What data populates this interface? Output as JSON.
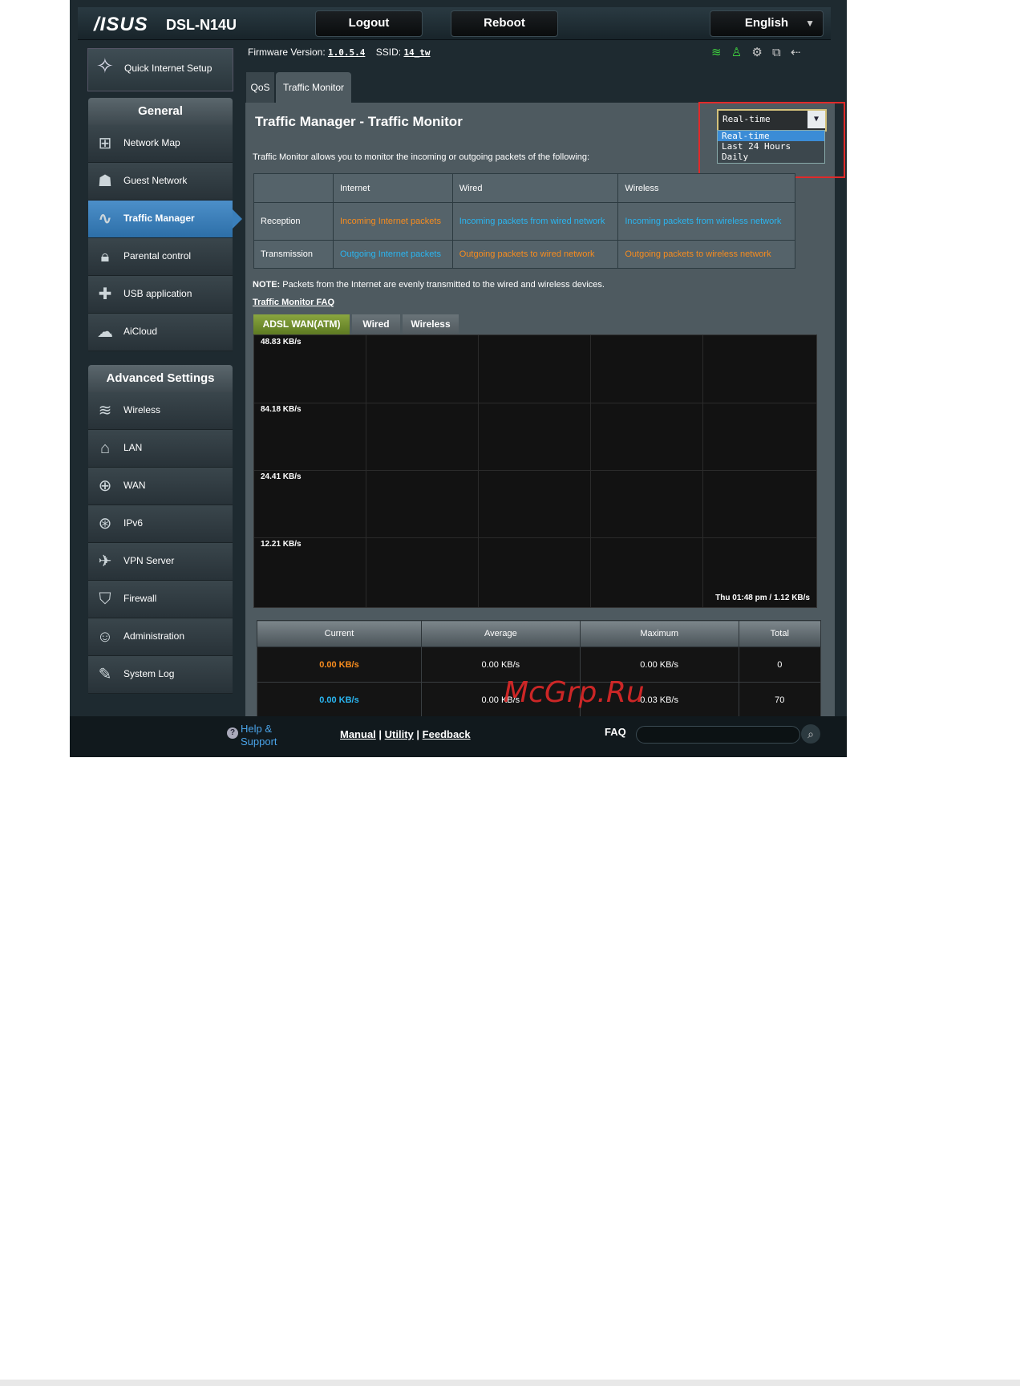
{
  "header": {
    "brand": "/ISUS",
    "model": "DSL-N14U",
    "logout_label": "Logout",
    "reboot_label": "Reboot",
    "language": "English"
  },
  "sidebar": {
    "quick_setup": "Quick Internet Setup",
    "general_title": "General",
    "general_items": [
      {
        "label": "Network Map",
        "icon": "network-map-icon"
      },
      {
        "label": "Guest Network",
        "icon": "guest-network-icon"
      },
      {
        "label": "Traffic Manager",
        "icon": "traffic-manager-icon"
      },
      {
        "label": "Parental control",
        "icon": "lock-icon"
      },
      {
        "label": "USB application",
        "icon": "puzzle-icon"
      },
      {
        "label": "AiCloud",
        "icon": "cloud-icon"
      }
    ],
    "advanced_title": "Advanced Settings",
    "advanced_items": [
      {
        "label": "Wireless",
        "icon": "wifi-icon"
      },
      {
        "label": "LAN",
        "icon": "home-icon"
      },
      {
        "label": "WAN",
        "icon": "globe-icon"
      },
      {
        "label": "IPv6",
        "icon": "ipv6-icon"
      },
      {
        "label": "VPN Server",
        "icon": "vpn-icon"
      },
      {
        "label": "Firewall",
        "icon": "shield-icon"
      },
      {
        "label": "Administration",
        "icon": "user-icon"
      },
      {
        "label": "System Log",
        "icon": "log-icon"
      }
    ]
  },
  "status": {
    "firmware_label": "Firmware Version:",
    "firmware_value": "1.0.5.4",
    "ssid_label": "SSID:",
    "ssid_value": "14_tw"
  },
  "tabs": [
    "QoS",
    "Traffic Monitor"
  ],
  "page": {
    "title": "Traffic Manager - Traffic Monitor",
    "select_value": "Real-time",
    "select_options": [
      "Real-time",
      "Last 24 Hours",
      "Daily"
    ],
    "description": "Traffic Monitor allows you to monitor the incoming or outgoing packets of the following:",
    "table": {
      "headers": [
        "",
        "Internet",
        "Wired",
        "Wireless"
      ],
      "rows": [
        [
          "Reception",
          "Incoming Internet packets",
          "Incoming packets from wired network",
          "Incoming packets from wireless network"
        ],
        [
          "Transmission",
          "Outgoing Internet packets",
          "Outgoing packets to wired network",
          "Outgoing packets to wireless network"
        ]
      ]
    },
    "note_label": "NOTE:",
    "note_text": " Packets from the Internet are evenly transmitted to the wired and wireless devices.",
    "faq_link": "Traffic Monitor FAQ"
  },
  "graph": {
    "tabs": [
      "ADSL WAN(ATM)",
      "Wired",
      "Wireless"
    ],
    "y_labels": [
      "48.83 KB/s",
      "84.18 KB/s",
      "24.41 KB/s",
      "12.21 KB/s"
    ],
    "timestamp": "Thu 01:48 pm / 1.12 KB/s"
  },
  "stats": {
    "headers": [
      "Current",
      "Average",
      "Maximum",
      "Total"
    ],
    "rows": [
      [
        "0.00 KB/s",
        "0.00 KB/s",
        "0.00 KB/s",
        "0"
      ],
      [
        "0.00 KB/s",
        "0.00 KB/s",
        "0.03 KB/s",
        "70"
      ]
    ]
  },
  "footer": {
    "help_label": "Help & Support",
    "manual": "Manual",
    "utility": "Utility",
    "feedback": "Feedback",
    "faq_label": "FAQ"
  },
  "watermark": "McGrp.Ru",
  "colors": {
    "accent_orange": "#f78c1e",
    "accent_blue": "#2ab5f0",
    "active_nav": "#3a7fbb",
    "highlight_box": "#e02a2a"
  }
}
